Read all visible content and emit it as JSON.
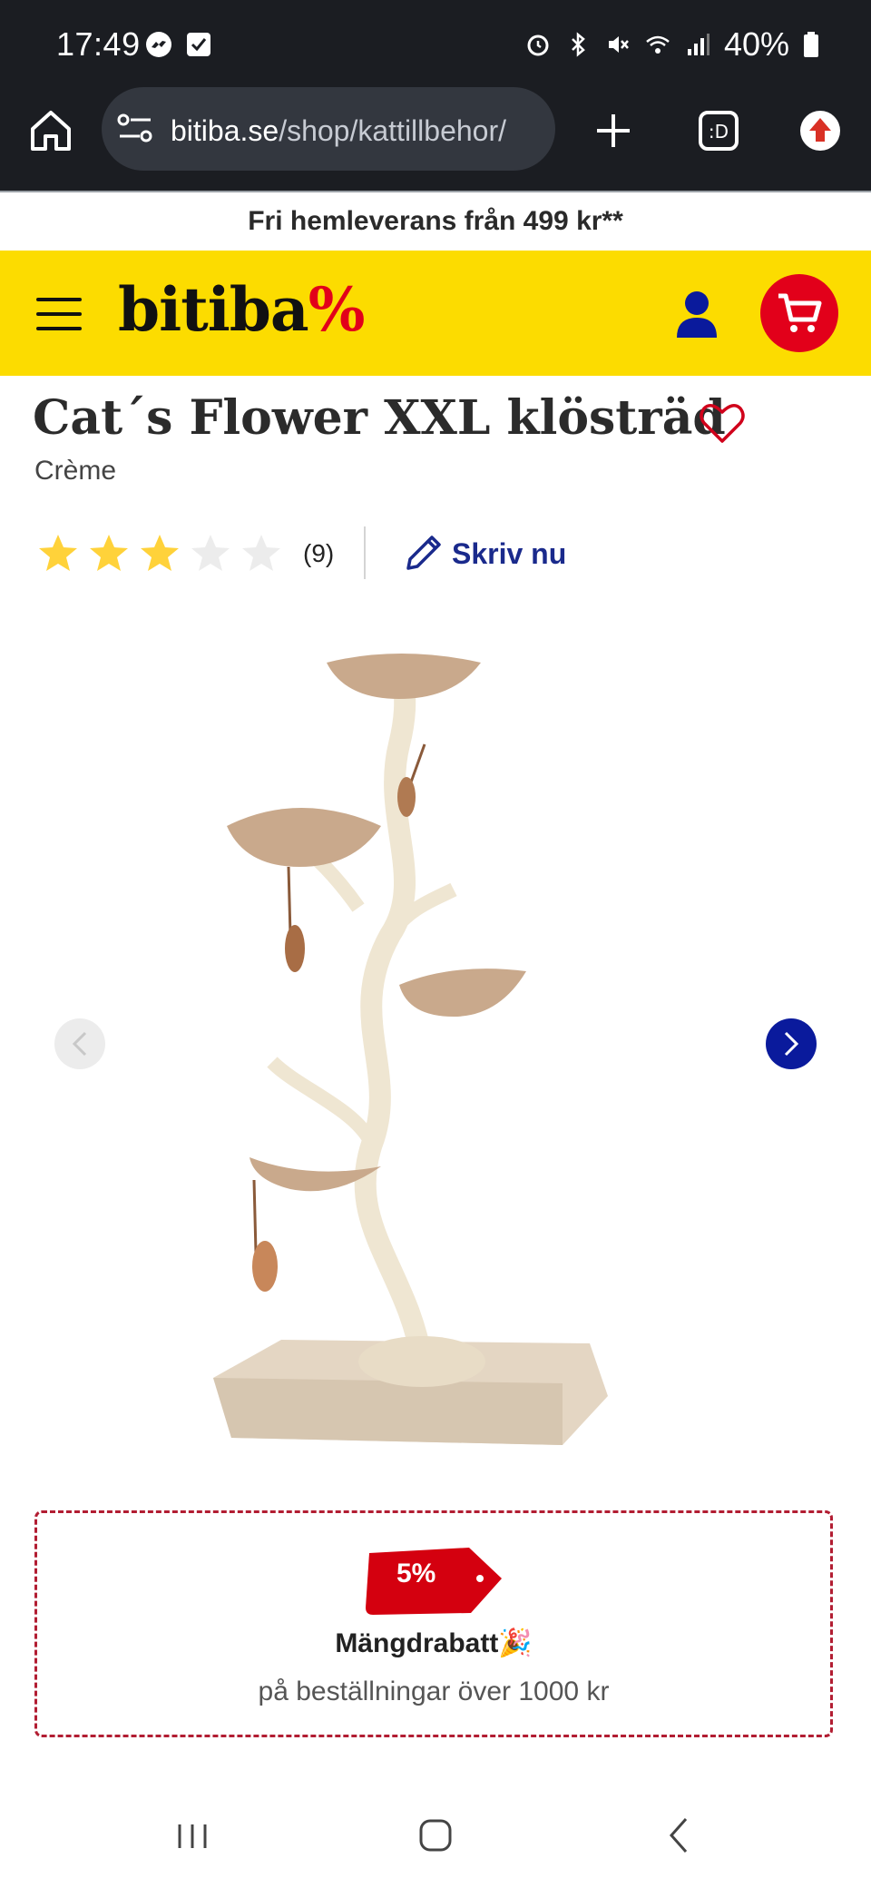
{
  "status_bar": {
    "time": "17:49",
    "battery": "40%",
    "icons_left": [
      "messenger-icon",
      "checkbox-icon"
    ],
    "icons_right": [
      "alarm-icon",
      "bluetooth-icon",
      "mute-icon",
      "wifi-icon",
      "signal-icon",
      "battery-icon"
    ]
  },
  "browser": {
    "url_domain": "bitiba.se",
    "url_path": "/shop/kattillbehor/"
  },
  "promo": {
    "text": "Fri hemleverans från 499 kr**"
  },
  "header": {
    "logo_text": "bitiba",
    "logo_symbol": "%",
    "brand_color": "#fcdc00",
    "accent_color": "#e2001a"
  },
  "product": {
    "title": "Cat´s Flower XXL klösträd",
    "variant": "Crème",
    "rating": 3,
    "rating_max": 5,
    "rating_count": "(9)",
    "write_review_label": "Skriv nu"
  },
  "discount": {
    "badge": "5%",
    "title": "Mängdrabatt🎉",
    "subtitle": "på beställningar över 1000 kr"
  }
}
